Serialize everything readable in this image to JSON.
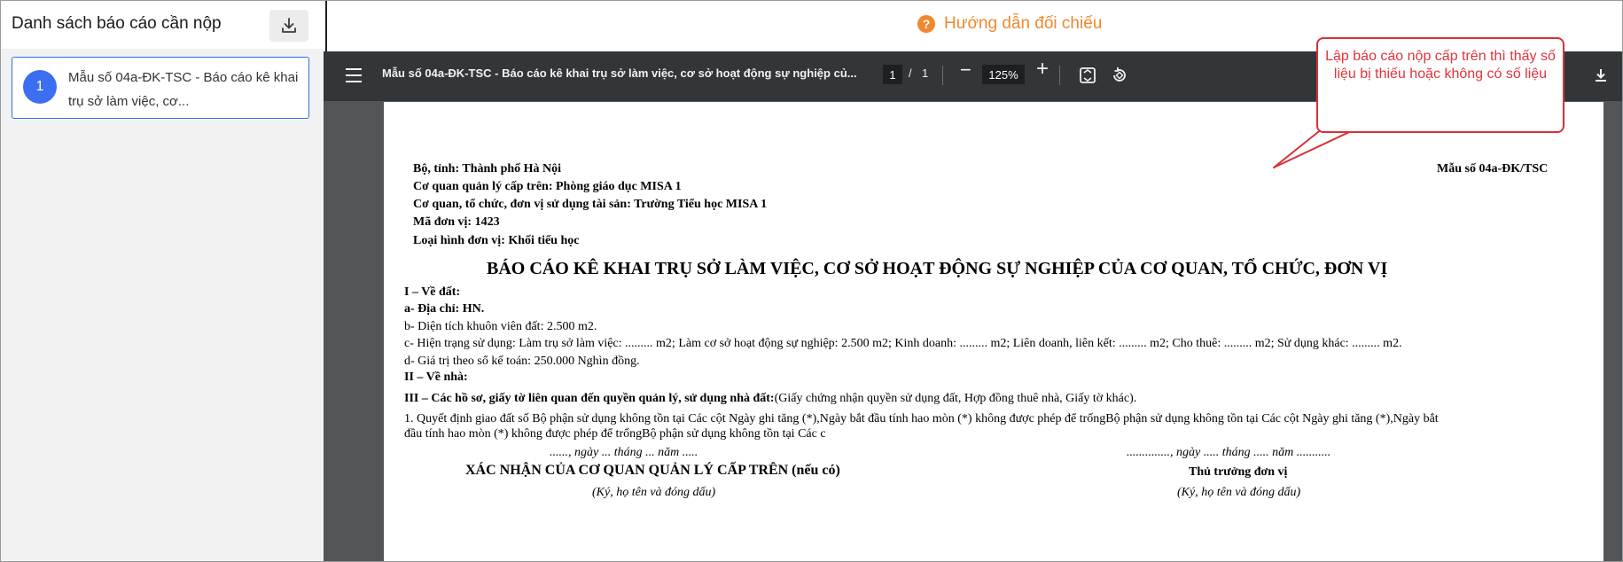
{
  "left_panel": {
    "title": "Danh sách báo cáo cần nộp",
    "download_icon": "download-icon",
    "reports": [
      {
        "index": "1",
        "label": "Mẫu số 04a-ĐK-TSC - Báo cáo kê khai trụ sở làm việc, cơ..."
      }
    ]
  },
  "guide": {
    "icon": "help-circle-icon",
    "label": "Hướng dẫn đối chiếu"
  },
  "toolbar": {
    "title": "Mẫu số 04a-ĐK-TSC - Báo cáo kê khai trụ sở làm việc, cơ sở hoạt động sự nghiệp củ...",
    "current_page": "1",
    "separator": "/",
    "total_pages": "1",
    "zoom_out": "−",
    "zoom": "125%",
    "zoom_in": "+"
  },
  "callout": {
    "text": "Lập báo cáo nộp cấp trên thì thấy số liệu bị thiếu hoặc không có số liệu"
  },
  "document": {
    "header_lines": [
      "Bộ, tỉnh: Thành phố Hà Nội",
      "Cơ quan quản lý cấp trên: Phòng giáo dục MISA 1",
      "Cơ quan, tổ chức, đơn vị sử dụng tài sản: Trường Tiểu học MISA 1",
      "Mã đơn vị: 1423",
      "Loại hình đơn vị: Khối tiểu học"
    ],
    "form_code": "Mẫu số 04a-ĐK/TSC",
    "title": "BÁO CÁO KÊ KHAI TRỤ SỞ LÀM VIỆC, CƠ SỞ HOẠT ĐỘNG SỰ NGHIỆP CỦA CƠ QUAN, TỔ CHỨC, ĐƠN VỊ",
    "section1": "I – Về đất:",
    "address": "a- Địa chỉ: HN.",
    "area": "b- Diện tích khuôn viên đất: 2.500  m2.",
    "usage": "c- Hiện trạng sử dụng: Làm trụ sở làm việc: ......... m2; Làm cơ sở hoạt động sự nghiệp: 2.500 m2; Kinh doanh: ......... m2; Liên doanh, liên kết: ......... m2; Cho thuê: ......... m2; Sử dụng khác: ......... m2.",
    "value": "d- Giá trị theo sổ kế toán: 250.000 Nghìn đồng.",
    "section2": "II – Về nhà:",
    "section3_bold": "III – Các hồ sơ, giấy tờ liên quan đến quyền quản lý, sử dụng nhà đất:",
    "section3_rest": "(Giấy chứng nhận quyền sử dụng đất, Hợp đồng thuê nhà, Giấy tờ khác).",
    "decision_line1": "1. Quyết định giao đất số Bộ phận sử dụng không tồn tại Các cột Ngày ghi tăng (*),Ngày bắt đầu tính hao mòn (*) không được phép để trốngBộ phận sử dụng không tồn tại Các cột Ngày ghi tăng (*),Ngày bắt",
    "decision_line2": "đầu tính hao mòn (*) không được phép để trốngBộ phận sử dụng không tồn tại Các c",
    "date_left": "......, ngày ... tháng ... năm .....",
    "date_right": ".............., ngày ..... tháng ..... năm ...........",
    "confirm_title": "XÁC NHẬN CỦA CƠ QUAN QUẢN LÝ CẤP TRÊN (nếu có)",
    "head_title": "Thủ trưởng đơn vị",
    "sign_left": "(Ký, họ tên và đóng dấu)",
    "sign_right": "(Ký, họ tên và đóng dấu)"
  }
}
